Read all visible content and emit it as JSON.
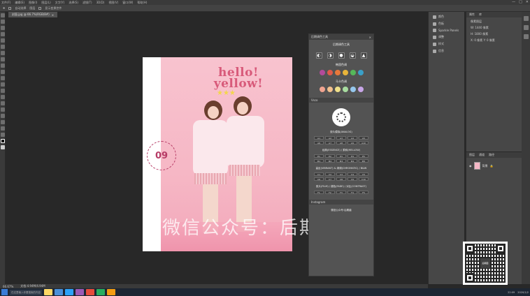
{
  "menubar": {
    "items": [
      "文件(F)",
      "编辑(E)",
      "图像(I)",
      "图层(L)",
      "文字(Y)",
      "选择(S)",
      "滤镜(T)",
      "3D(D)",
      "视图(V)",
      "窗口(W)",
      "帮助(H)"
    ],
    "win_min": "—",
    "win_max": "□",
    "win_close": "✕"
  },
  "optbar": {
    "auto_select": "自动选择",
    "layer": "图层",
    "show_transform": "显示变换控件"
  },
  "doc_tab": {
    "title": "封面.jpg @ 66.7%(RGB/8#)",
    "close": "×"
  },
  "artboard": {
    "headline_1": "hello!",
    "headline_2": "yellow!",
    "stars": "★★★",
    "badge_number": "09"
  },
  "watermark": "微信公众号：后期菌",
  "plugin": {
    "title": "后期调色工具",
    "close": "×",
    "subtitle": "后期调色工具",
    "icons": [
      "◐",
      "◑",
      "●",
      "◒",
      "▲"
    ],
    "section1_label": "韩国色调",
    "section1_colors": [
      "#b34a9a",
      "#e05a4a",
      "#e8783a",
      "#e8b43a",
      "#56b85a",
      "#3aa0c8"
    ],
    "section2_label": "马卡色调",
    "section2_colors": [
      "#f0a490",
      "#f2c08e",
      "#efe08a",
      "#a8dca0",
      "#96c8ee",
      "#c8a6e8"
    ],
    "vsco_header": "Vsco",
    "presets_label": "胶片模拟(ANALOG)",
    "presets_buttons": [
      "A1",
      "A2",
      "A3",
      "A4",
      "A5",
      "A6",
      "A7",
      "A8",
      "A9",
      "A10"
    ],
    "classic_label": "经典(ESSENCE) / 柔和(MELLOW)",
    "classic_buttons": [
      "E1",
      "E2",
      "E3",
      "E4",
      "E5",
      "M1",
      "M2",
      "M3",
      "M4",
      "M5"
    ],
    "chrome_label": "高反(VIBRANT) & 绿调(CHROMATIC) / B&W",
    "chrome_buttons": [
      "C1",
      "C2",
      "C3",
      "C4",
      "C5",
      "C6",
      "C7",
      "C8",
      "C9",
      "C10"
    ],
    "film_label": "胶片(FILM) / 褪色(FADE) / 对比(CONTRAST)",
    "film_buttons": [
      "F1",
      "F2",
      "F3",
      "F4",
      "F5"
    ],
    "instagram_header": "Instagram",
    "instagram_text": "微信公众号:后期菌"
  },
  "rpanel_a": {
    "items": [
      "颜色",
      "色板",
      "Sparkle Panels",
      "调整",
      "样式",
      "信息"
    ]
  },
  "rpanel_b": {
    "tabs": [
      "属性",
      "库"
    ],
    "line1": "像素图层",
    "line2": "W: 1440 像素",
    "line3": "H: 1800 像素",
    "line4": "X: 0 像素  Y: 0 像素"
  },
  "rpanel_c": {
    "tabs": [
      "图层",
      "通道",
      "路径"
    ],
    "layer_name": "背景"
  },
  "statusbar": {
    "zoom": "66.67%",
    "doc": "文档:4.94M/4.94M"
  },
  "taskbar": {
    "search": "在这里输入你要搜索的内容",
    "time": "22:09",
    "date": "2020/1/2"
  },
  "qr": {
    "center": "后期菌"
  }
}
